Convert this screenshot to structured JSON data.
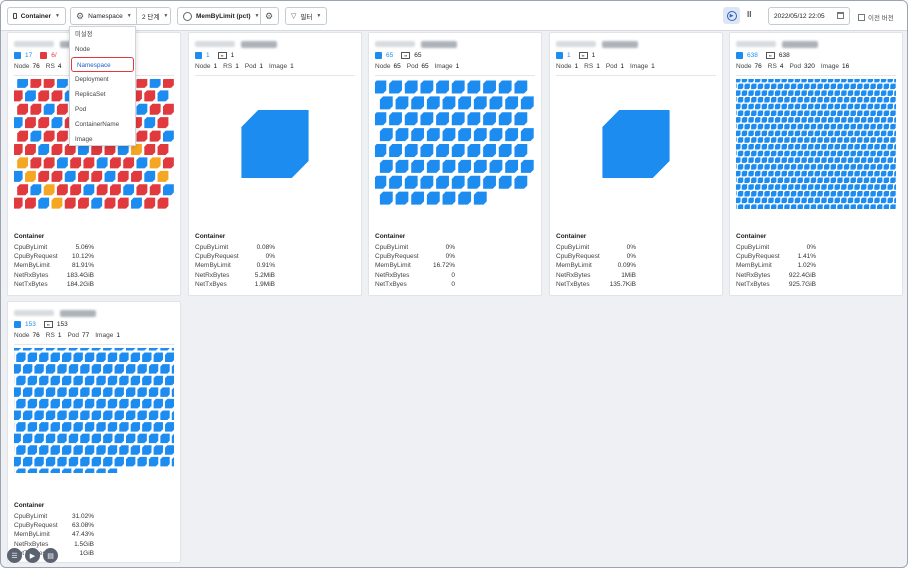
{
  "toolbar": {
    "container_label": "Container",
    "group_label": "Namespace",
    "level_label": "2 단계",
    "metric_label": "MemByLimit (pct)",
    "filter_label": "필터",
    "date_value": "2022/05/12 22:05",
    "prev_version_label": "이전 버전"
  },
  "dropdown": {
    "items": [
      "미설정",
      "Node",
      "Namespace",
      "Deployment",
      "ReplicaSet",
      "Pod",
      "ContainerName",
      "Image"
    ],
    "selected": "Namespace"
  },
  "labels": {
    "node": "Node",
    "rs": "RS",
    "pod": "Pod",
    "image": "Image",
    "section": "Container"
  },
  "cards": [
    {
      "count_blue": "17",
      "count_red": "6/",
      "count_pod": "",
      "node": "76",
      "rs": "4",
      "pod": "",
      "image": "",
      "metrics": [
        [
          "CpuByLimit",
          "5.06%"
        ],
        [
          "CpuByRequest",
          "10.12%"
        ],
        [
          "MemByLimit",
          "81.91%"
        ],
        [
          "NetRxBytes",
          "183.4GiB"
        ],
        [
          "NetTxBytes",
          "184.2GiB"
        ]
      ]
    },
    {
      "count_blue": "1",
      "count_red": "",
      "count_pod": "1",
      "node": "1",
      "rs": "1",
      "pod": "1",
      "image": "1",
      "metrics": [
        [
          "CpuByLimit",
          "0.08%"
        ],
        [
          "CpuByRequest",
          "0%"
        ],
        [
          "MemByLimit",
          "0.91%"
        ],
        [
          "NetRxBytes",
          "5.2MiB"
        ],
        [
          "NetTxByes",
          "1.9MiB"
        ]
      ]
    },
    {
      "count_blue": "65",
      "count_red": "",
      "count_pod": "65",
      "node": "65",
      "rs": "",
      "pod": "65",
      "image": "1",
      "metrics": [
        [
          "CpuByLimit",
          "0%"
        ],
        [
          "CpuByRequest",
          "0%"
        ],
        [
          "MemByLimit",
          "16.72%"
        ],
        [
          "NetRxBytes",
          "0"
        ],
        [
          "NetTxByes",
          "0"
        ]
      ]
    },
    {
      "count_blue": "1",
      "count_red": "",
      "count_pod": "1",
      "node": "1",
      "rs": "1",
      "pod": "1",
      "image": "1",
      "metrics": [
        [
          "CpuByLimit",
          "0%"
        ],
        [
          "CpuByRequest",
          "0%"
        ],
        [
          "MemByLimit",
          "0.09%"
        ],
        [
          "NetRxBytes",
          "1MiB"
        ],
        [
          "NetTxBytes",
          "135.7KiB"
        ]
      ]
    },
    {
      "count_blue": "638",
      "count_red": "",
      "count_pod": "638",
      "node": "76",
      "rs": "4",
      "pod": "320",
      "image": "16",
      "metrics": [
        [
          "CpuByLimit",
          "0%"
        ],
        [
          "CpuByRequest",
          "1.41%"
        ],
        [
          "MemByLimit",
          "1.02%"
        ],
        [
          "NetRxBytes",
          "922.4GiB"
        ],
        [
          "NetTxBytes",
          "925.7GiB"
        ]
      ]
    },
    {
      "count_blue": "153",
      "count_red": "",
      "count_pod": "153",
      "node": "76",
      "rs": "1",
      "pod": "77",
      "image": "1",
      "metrics": [
        [
          "CpuByLimit",
          "31.02%"
        ],
        [
          "CpuByRequest",
          "63.08%"
        ],
        [
          "MemByLimit",
          "47.43%"
        ],
        [
          "NetRxBytes",
          "1.5GiB"
        ],
        [
          "NetTxByes",
          "1GiB"
        ]
      ]
    }
  ],
  "colors": {
    "blue": "#1d8cf0",
    "red": "#e0393e",
    "orange": "#f5a623"
  },
  "fabs": [
    "list-icon",
    "play-icon",
    "clipboard-icon"
  ]
}
